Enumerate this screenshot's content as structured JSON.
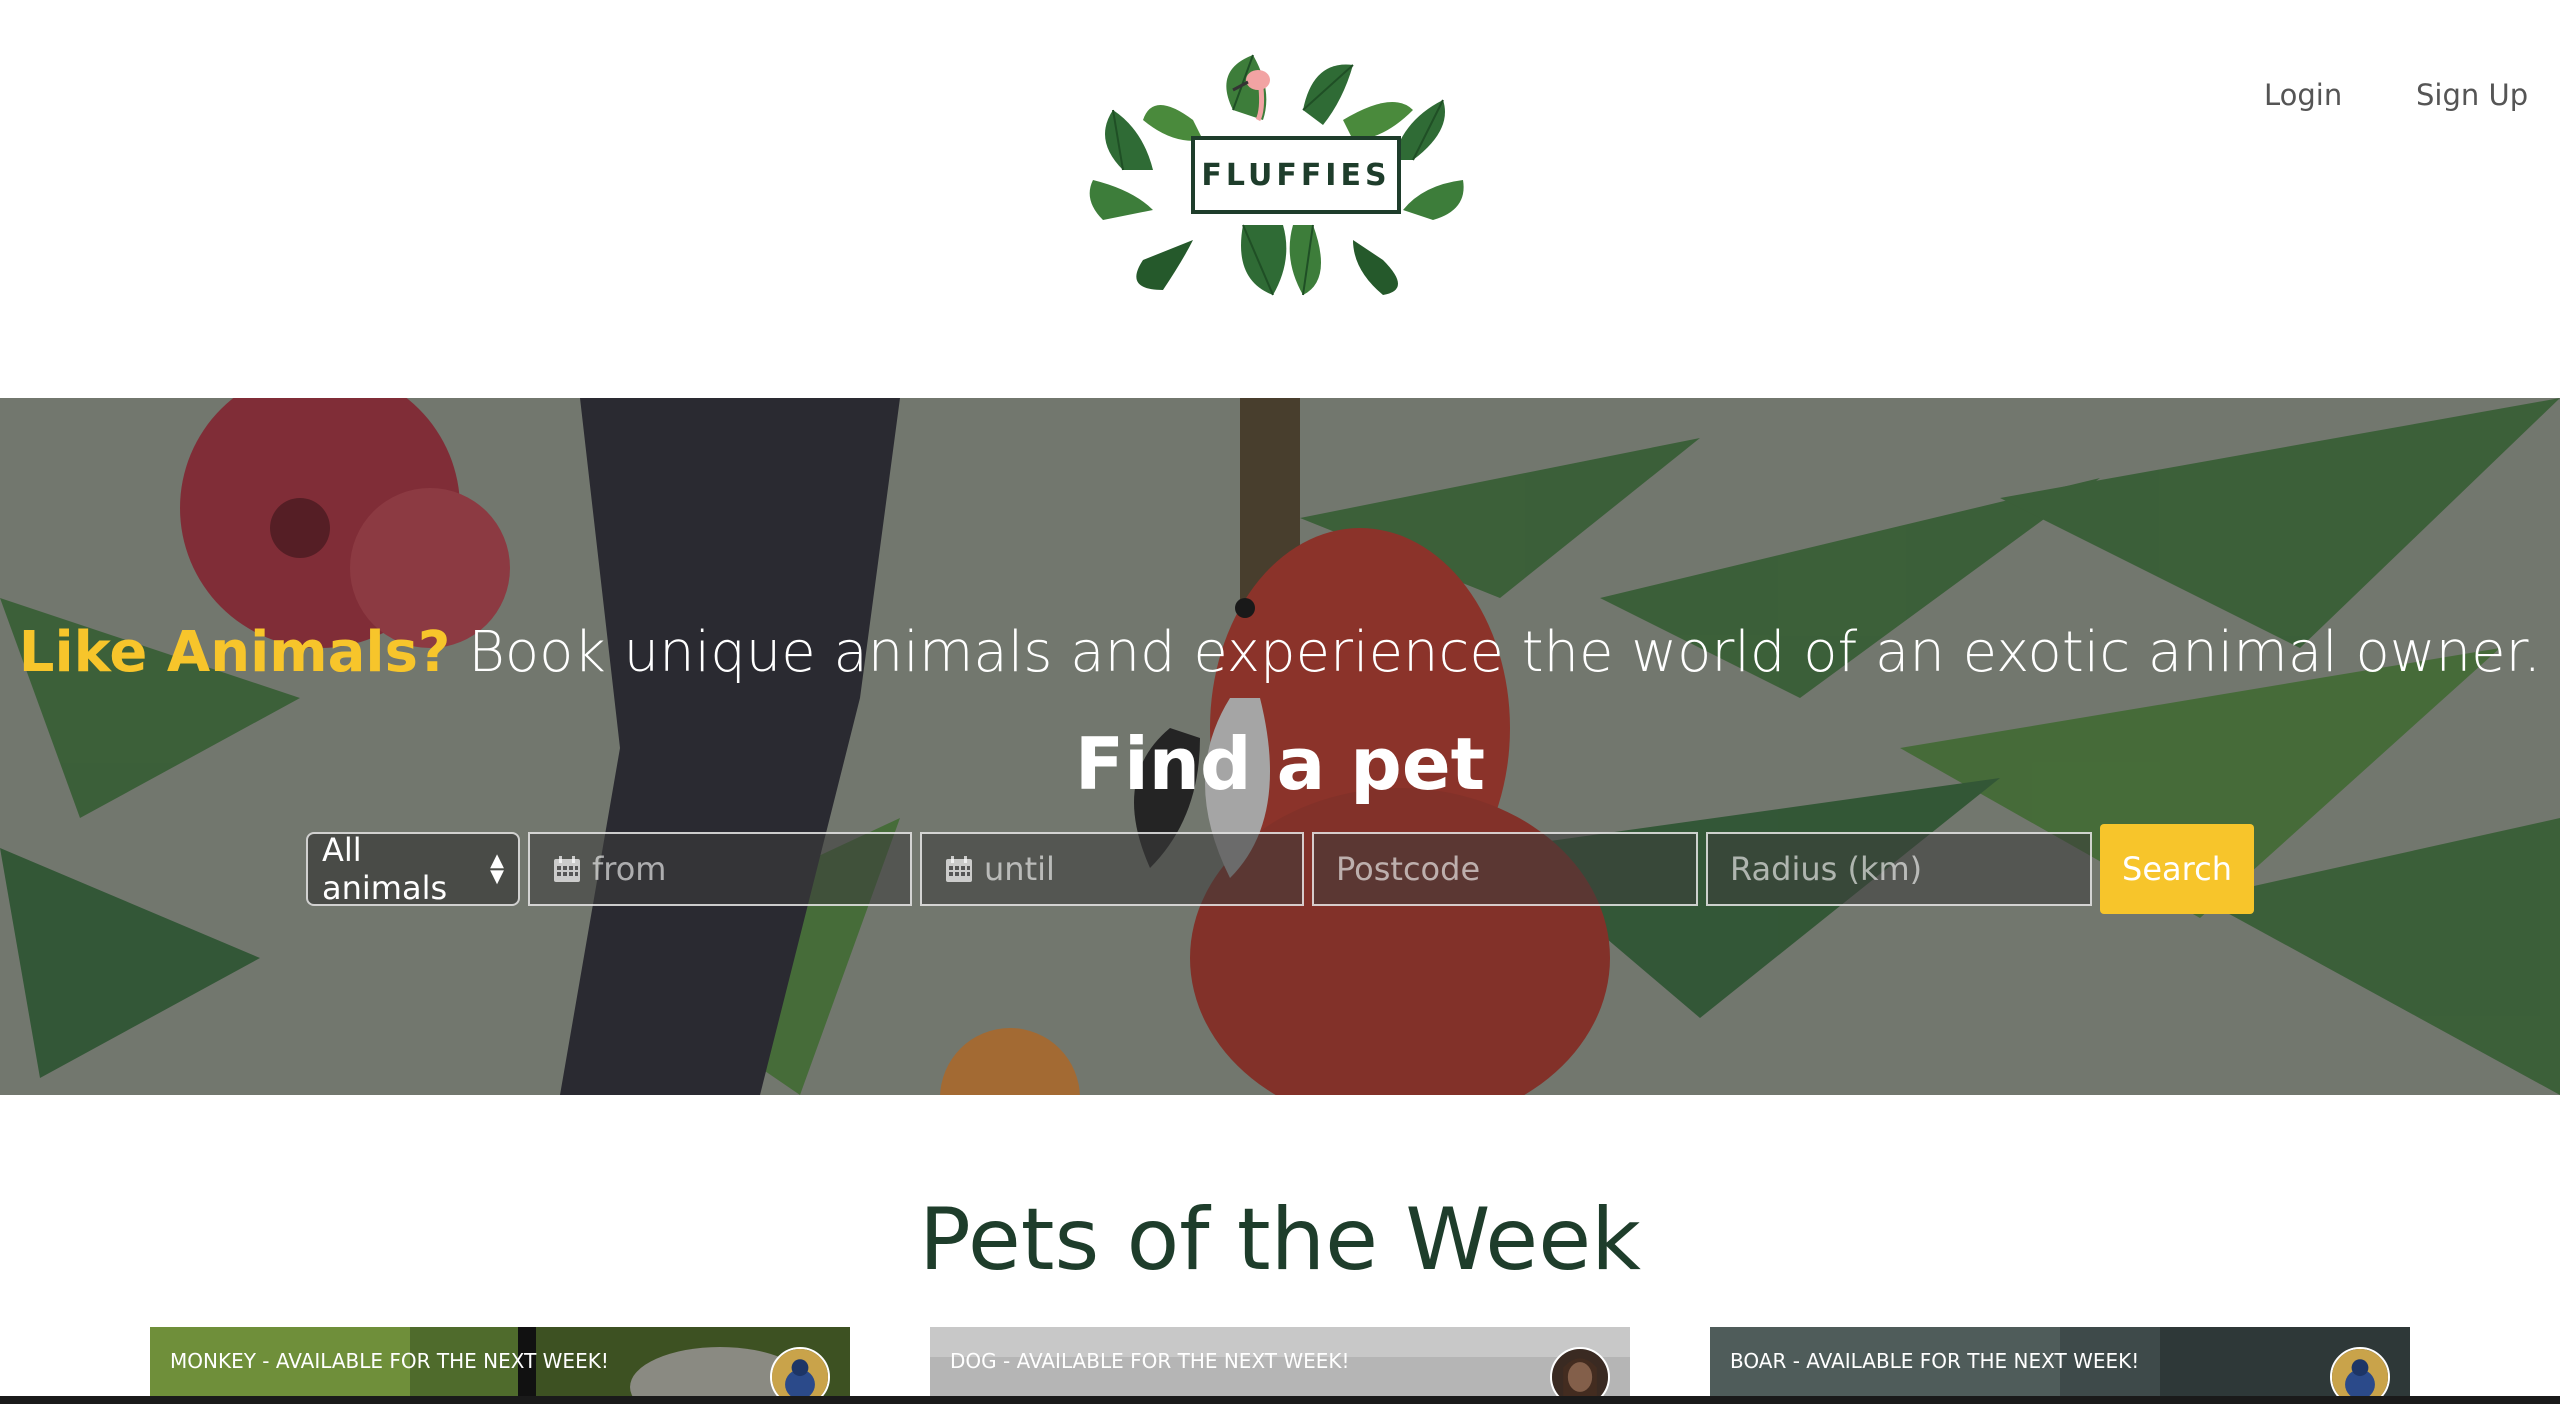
{
  "header": {
    "logo_text": "FLUFFIES",
    "nav": {
      "login": "Login",
      "signup": "Sign Up"
    }
  },
  "hero": {
    "tagline_accent": "Like Animals?",
    "tagline_rest": " Book unique animals and experience the world of an exotic animal owner.",
    "title": "Find a pet",
    "search": {
      "animal_select_value": "All animals",
      "from_placeholder": "from",
      "until_placeholder": "until",
      "postcode_placeholder": "Postcode",
      "radius_placeholder": "Radius (km)",
      "button_label": "Search"
    }
  },
  "pets": {
    "title": "Pets of the Week",
    "cards": [
      {
        "label": "MONKEY - AVAILABLE FOR THE NEXT WEEK!"
      },
      {
        "label": "DOG - AVAILABLE FOR THE NEXT WEEK!"
      },
      {
        "label": "BOAR - AVAILABLE FOR THE NEXT WEEK!"
      }
    ]
  },
  "colors": {
    "accent": "#f7c52b",
    "brand_green": "#1e3d2b",
    "nav_text": "#555555"
  }
}
